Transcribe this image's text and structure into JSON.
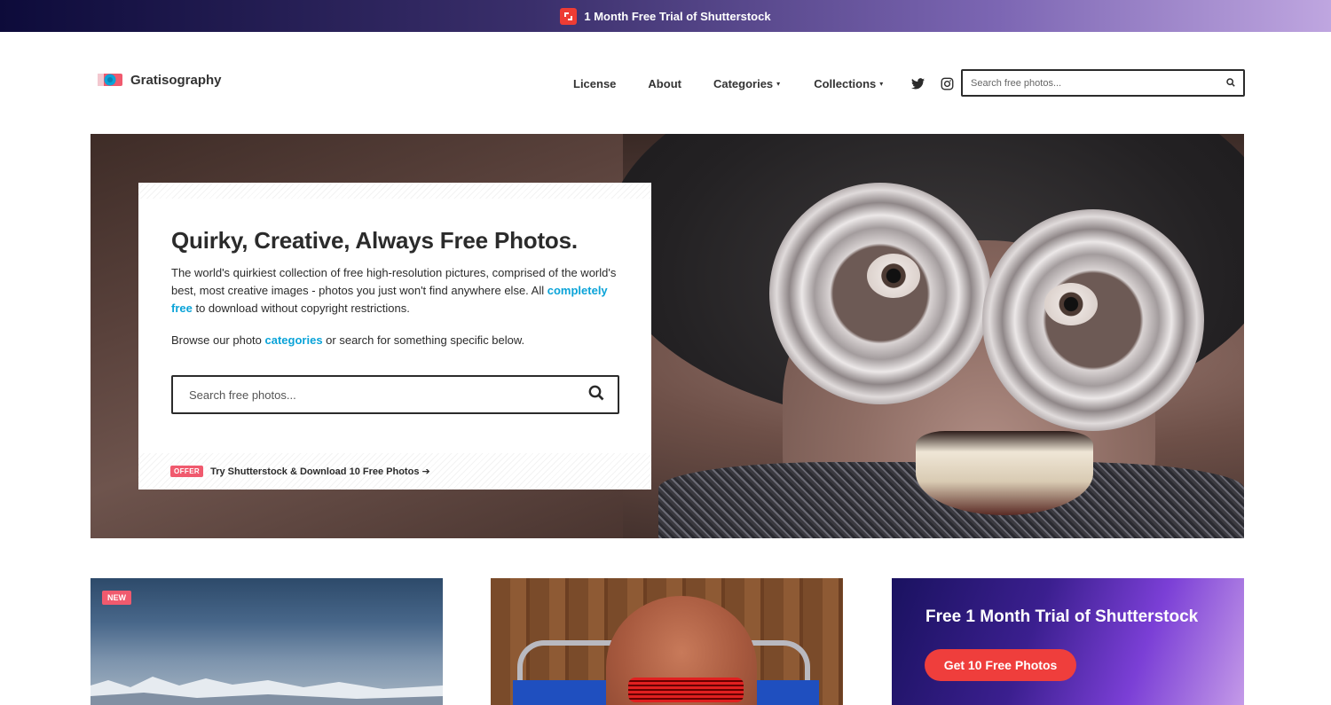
{
  "promo_bar": {
    "text": "1 Month Free Trial of Shutterstock",
    "logo_icon": "shutterstock-logo-icon",
    "logo_color": "#ee3c34"
  },
  "header": {
    "logo_text": "Gratisography",
    "nav": [
      {
        "label": "License"
      },
      {
        "label": "About"
      },
      {
        "label": "Categories",
        "dropdown": true
      },
      {
        "label": "Collections",
        "dropdown": true
      }
    ],
    "social_icons": [
      "twitter-icon",
      "instagram-icon"
    ],
    "search": {
      "placeholder": "Search free photos..."
    }
  },
  "hero": {
    "title": "Quirky, Creative, Always Free Photos.",
    "para_part1": "The world's quirkiest collection of free high-resolution pictures, comprised of the world's best, most creative images - photos you just won't find anywhere else. All ",
    "para_link": "completely free",
    "para_part2": " to download without copyright restrictions.",
    "browse_part1": "Browse our photo ",
    "browse_link": "categories",
    "browse_part2": " or search for something specific below.",
    "search": {
      "placeholder": "Search free photos..."
    },
    "offer_badge": "OFFER",
    "offer_text": "Try Shutterstock & Download 10 Free Photos",
    "link_color": "#0aa3d8"
  },
  "cards": {
    "card1_badge": "NEW",
    "card3_title": "Free 1 Month Trial of Shutterstock",
    "card3_button": "Get 10 Free Photos",
    "accent_color": "#ef3e3c"
  }
}
